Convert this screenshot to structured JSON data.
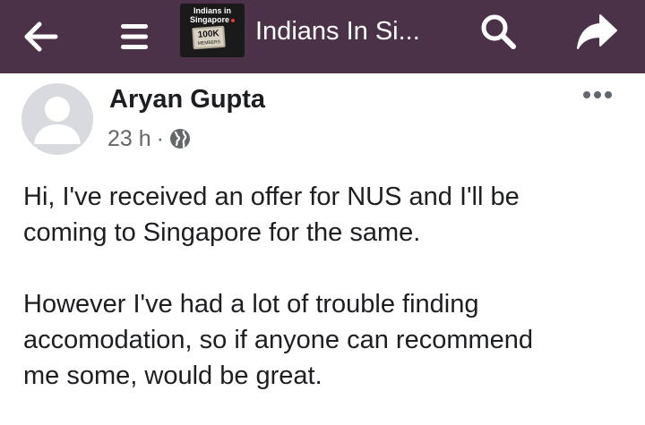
{
  "header": {
    "group_title": "Indians In Si...",
    "logo": {
      "line1": "Indians in",
      "line2": "Singapore",
      "stamp_number": "100K",
      "stamp_sub": "MEMBERS"
    },
    "icons": {
      "back": "arrow-left-icon",
      "menu": "hamburger-menu-icon",
      "search": "search-icon",
      "share": "share-icon"
    },
    "colors": {
      "bar": "#4b3248",
      "icon": "#ffffff"
    }
  },
  "post": {
    "author": "Aryan Gupta",
    "time": "23 h",
    "separator": "·",
    "privacy_icon": "globe-icon",
    "more_icon": "more-horizontal-icon",
    "paragraphs": [
      "Hi, I've received an offer for NUS and I'll be\ncoming to Singapore for the same.",
      "However I've had a lot of trouble finding\naccomodation, so if anyone can recommend\nme some, would be great."
    ]
  }
}
